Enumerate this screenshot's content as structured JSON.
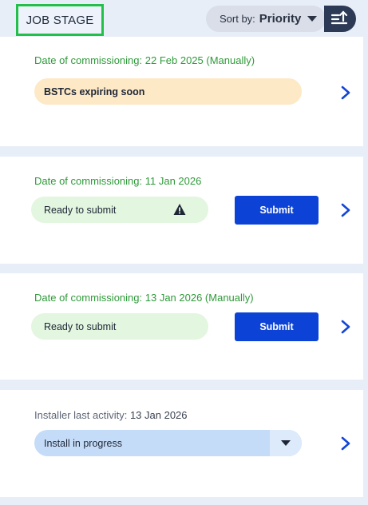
{
  "header": {
    "job_stage_label": "JOB STAGE",
    "sort_label": "Sort by:",
    "sort_value": "Priority"
  },
  "jobs": [
    {
      "date_label": "Date of commissioning:",
      "date_value": "22 Feb 2025 (Manually)",
      "status": "BSTCs expiring soon",
      "status_color": "#fde9c6"
    },
    {
      "date_label": "Date of commissioning:",
      "date_value": "11 Jan 2026",
      "status": "Ready to submit",
      "status_icon": "warning-icon",
      "action": "Submit"
    },
    {
      "date_label": "Date of commissioning:",
      "date_value": "13 Jan 2026 (Manually)",
      "status": "Ready to submit",
      "action": "Submit"
    },
    {
      "date_label": "Installer last activity:",
      "date_value": "13 Jan 2026",
      "status": "Install in progress",
      "status_icon": "caret-down-icon"
    }
  ],
  "colors": {
    "accent": "#0c43d6",
    "green_text": "#2f9a3a",
    "highlight_border": "#22c04a"
  }
}
